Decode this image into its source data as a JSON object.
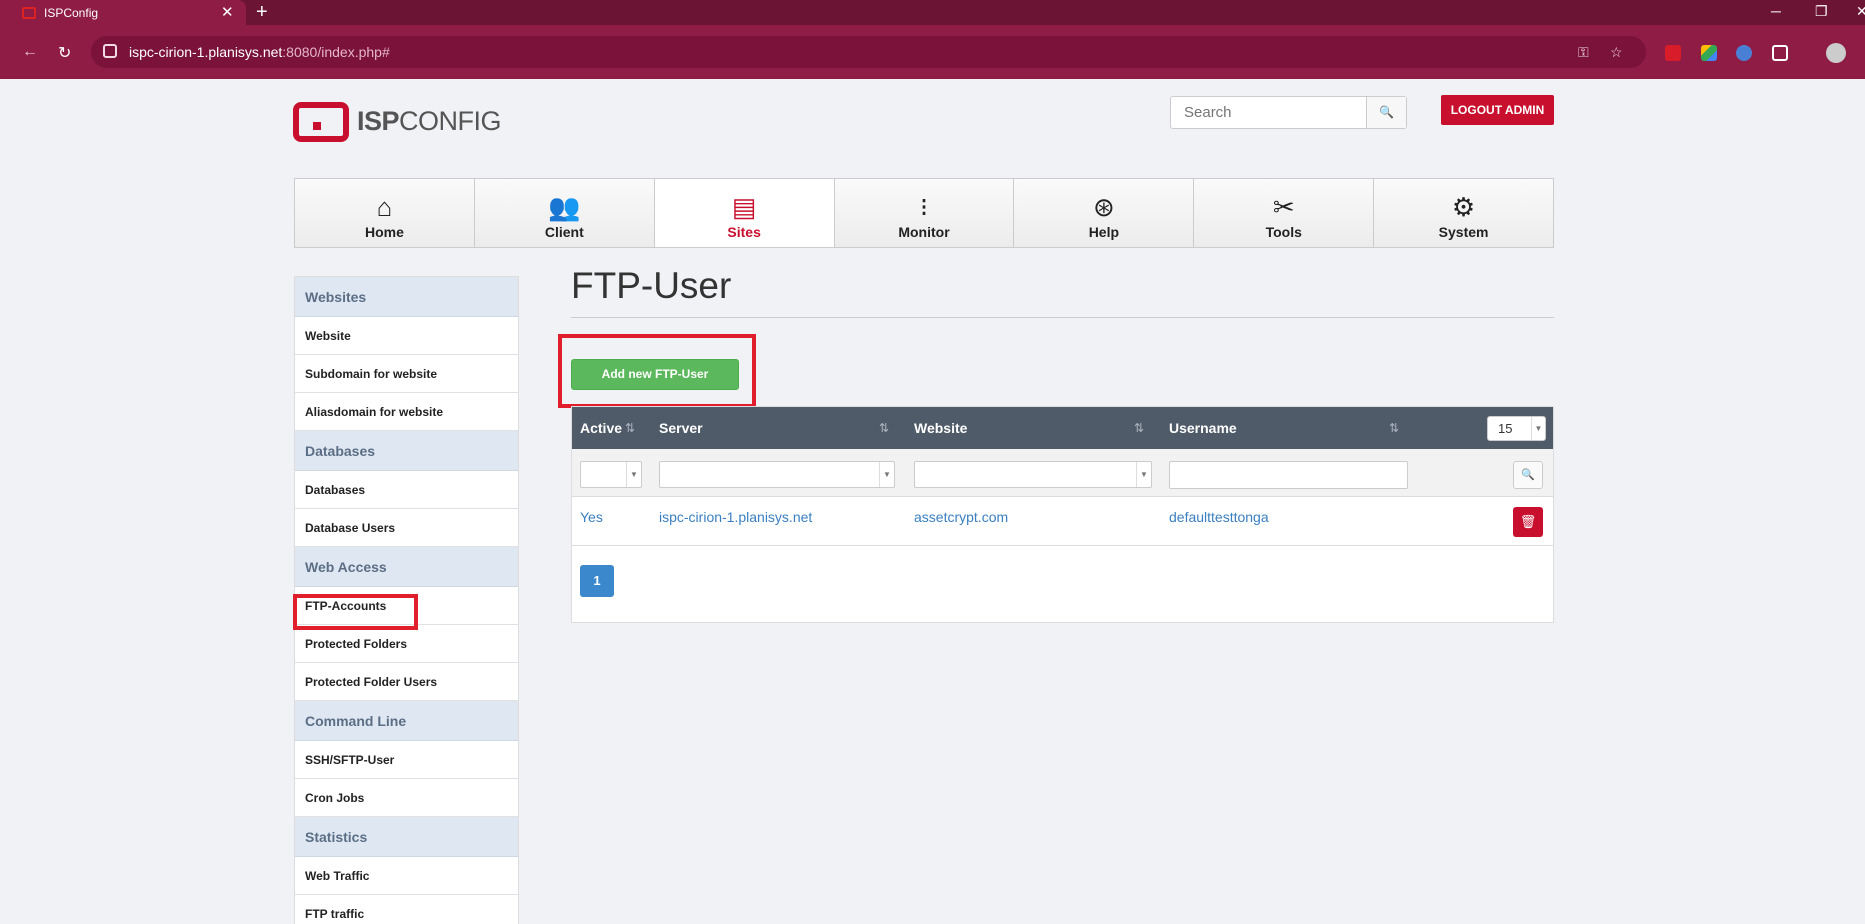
{
  "browser": {
    "tab_title": "ISPConfig",
    "tab_close": "✕",
    "new_tab": "+",
    "url_host": "ispc-cirion-1.planisys.net",
    "url_path": ":8080/index.php#",
    "win_min": "─",
    "win_restore": "❐",
    "win_close": "✕"
  },
  "header": {
    "logo_bold": "ISP",
    "logo_light": "CONFIG",
    "search_placeholder": "Search",
    "logout_label": "LOGOUT ADMIN"
  },
  "nav": {
    "items": [
      {
        "label": "Home",
        "icon": "home-icon",
        "glyph": "⌂"
      },
      {
        "label": "Client",
        "icon": "users-icon",
        "glyph": "👥"
      },
      {
        "label": "Sites",
        "icon": "sites-icon",
        "glyph": "▤"
      },
      {
        "label": "Monitor",
        "icon": "traffic-light-icon",
        "glyph": "⁝"
      },
      {
        "label": "Help",
        "icon": "lifebuoy-icon",
        "glyph": "⊛"
      },
      {
        "label": "Tools",
        "icon": "tools-icon",
        "glyph": "✂"
      },
      {
        "label": "System",
        "icon": "gear-icon",
        "glyph": "⚙"
      }
    ],
    "active": "Sites"
  },
  "sidebar": {
    "sections": [
      {
        "title": "Websites",
        "items": [
          "Website",
          "Subdomain for website",
          "Aliasdomain for website"
        ]
      },
      {
        "title": "Databases",
        "items": [
          "Databases",
          "Database Users"
        ]
      },
      {
        "title": "Web Access",
        "items": [
          "FTP-Accounts",
          "Protected Folders",
          "Protected Folder Users"
        ]
      },
      {
        "title": "Command Line",
        "items": [
          "SSH/SFTP-User",
          "Cron Jobs"
        ]
      },
      {
        "title": "Statistics",
        "items": [
          "Web Traffic",
          "FTP traffic"
        ]
      }
    ]
  },
  "main": {
    "title": "FTP-User",
    "add_button": "Add new FTP-User",
    "table": {
      "columns": [
        "Active",
        "Server",
        "Website",
        "Username"
      ],
      "per_page": "15",
      "rows": [
        {
          "active": "Yes",
          "server": "ispc-cirion-1.planisys.net",
          "website": "assetcrypt.com",
          "username": "defaulttesttonga"
        }
      ],
      "current_page": "1"
    }
  },
  "colors": {
    "brand": "#c8102e",
    "browser_frame": "#8e1c45",
    "table_header": "#505b69",
    "add_button": "#5cb85c",
    "link": "#3a7fc1",
    "highlight": "#e01e2c"
  }
}
